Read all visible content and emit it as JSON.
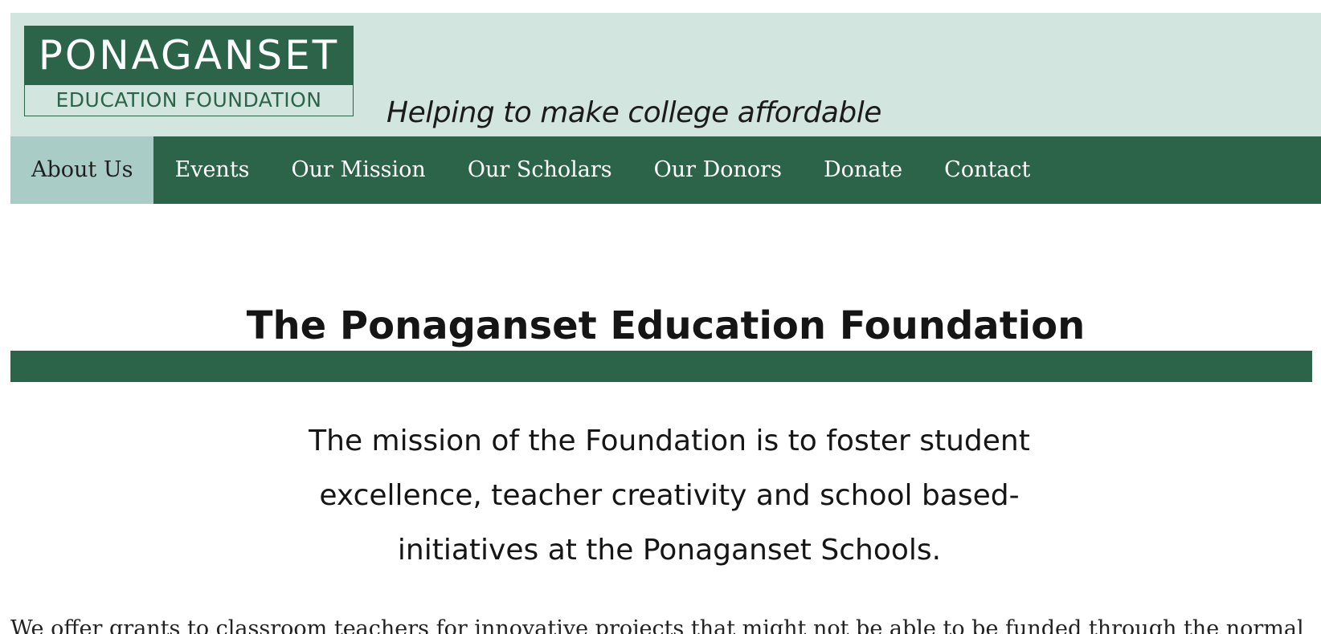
{
  "header": {
    "logo": {
      "line1": "PONAGANSET",
      "line2": "EDUCATION FOUNDATION"
    },
    "tagline": "Helping to make college affordable"
  },
  "nav": {
    "items": [
      {
        "label": "About Us",
        "active": true
      },
      {
        "label": "Events",
        "active": false
      },
      {
        "label": "Our Mission",
        "active": false
      },
      {
        "label": "Our Scholars",
        "active": false
      },
      {
        "label": "Our Donors",
        "active": false
      },
      {
        "label": "Donate",
        "active": false
      },
      {
        "label": "Contact",
        "active": false
      }
    ]
  },
  "main": {
    "title": "The Ponaganset Education Foundation",
    "mission_lines": [
      "The mission of the Foundation is to foster student",
      "excellence, teacher creativity and school based-",
      "initiatives at the Ponaganset Schools."
    ],
    "paragraph": "We offer grants to classroom teachers for innovative projects that might not be able to be funded through the normal"
  },
  "colors": {
    "brand_green": "#2b6449",
    "header_mint": "#d2e5df",
    "nav_active": "#a9ccc6"
  }
}
